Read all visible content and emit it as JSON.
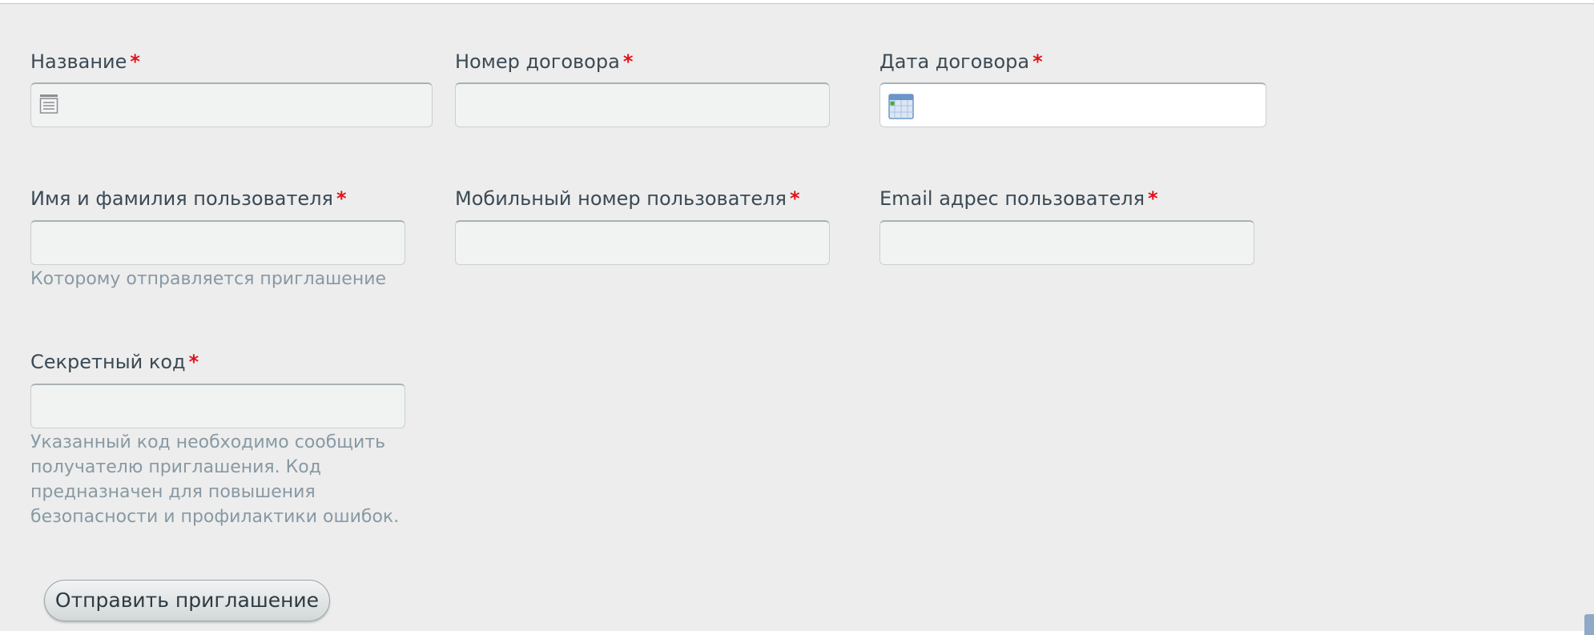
{
  "form": {
    "name": {
      "label": "Название",
      "required": "*"
    },
    "contract_number": {
      "label": "Номер договора",
      "required": "*"
    },
    "contract_date": {
      "label": "Дата договора",
      "required": "*"
    },
    "user_full_name": {
      "label": "Имя и фамилия пользователя",
      "required": "*",
      "hint": "Которому отправляется приглашение"
    },
    "user_mobile": {
      "label": "Мобильный номер пользователя",
      "required": "*"
    },
    "user_email": {
      "label": "Email адрес пользователя",
      "required": "*"
    },
    "secret_code": {
      "label": "Секретный код",
      "required": "*",
      "hint_lines": [
        "Указанный код необходимо сообщить",
        "получателю приглашения. Код",
        "предназначен для повышения",
        "безопасности и профилактики ошибок."
      ]
    },
    "submit_label": "Отправить приглашение"
  },
  "icons": {
    "name_field": "list-icon",
    "date_field": "calendar-icon"
  },
  "colors": {
    "required": "#e0121b",
    "hint": "#8899a4",
    "label": "#3b4a55",
    "panel_bg": "#ededed"
  }
}
